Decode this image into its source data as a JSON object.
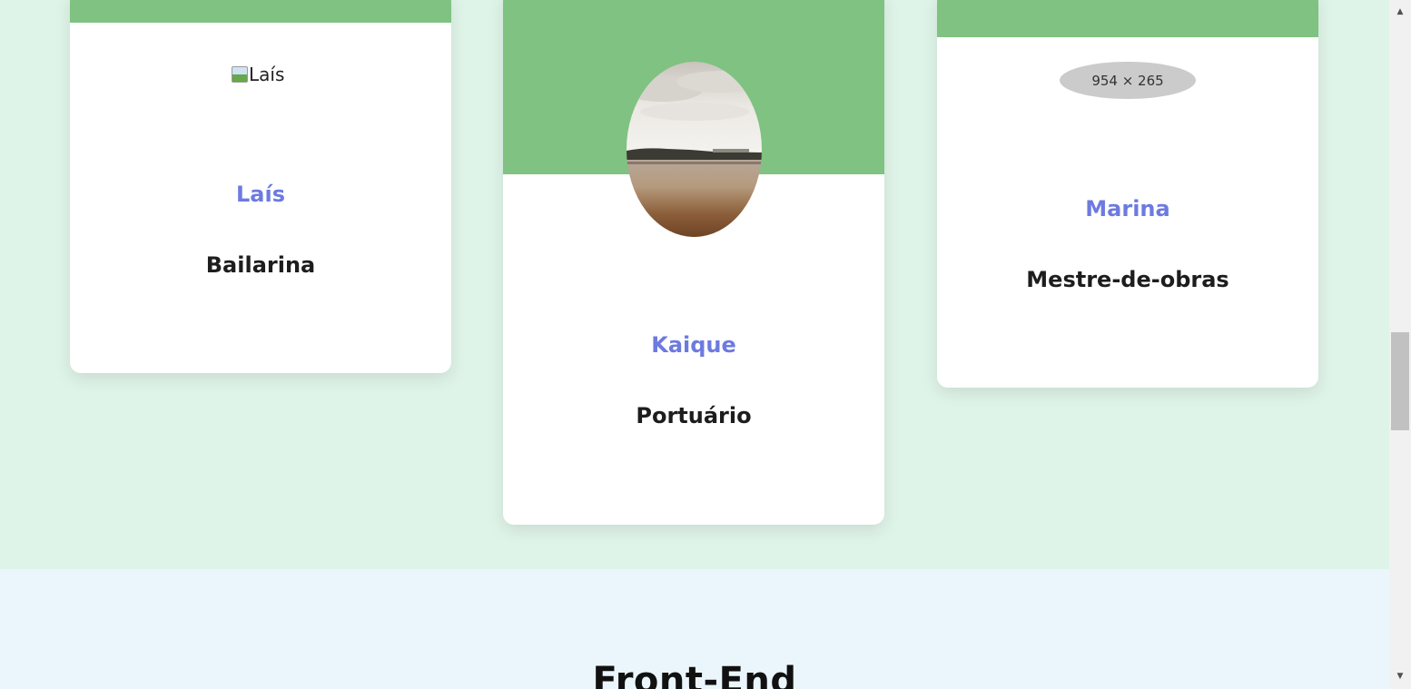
{
  "cards": [
    {
      "name": "Laís",
      "role": "Bailarina",
      "image_alt": "Laís"
    },
    {
      "name": "Kaique",
      "role": "Portuário",
      "image": "lake-landscape-photo"
    },
    {
      "name": "Marina",
      "role": "Mestre-de-obras",
      "image_placeholder": "954 × 265"
    }
  ],
  "next_section": {
    "title": "Front-End"
  },
  "colors": {
    "page_background": "#dff4e8",
    "next_section_background": "#ebf6fc",
    "card_band": "#7fc281",
    "name_text": "#6d7ae0",
    "role_text": "#1d1d1d"
  },
  "icons": {
    "broken_image": "broken-image-icon",
    "scroll_up": "chevron-up-icon",
    "scroll_down": "chevron-down-icon"
  }
}
